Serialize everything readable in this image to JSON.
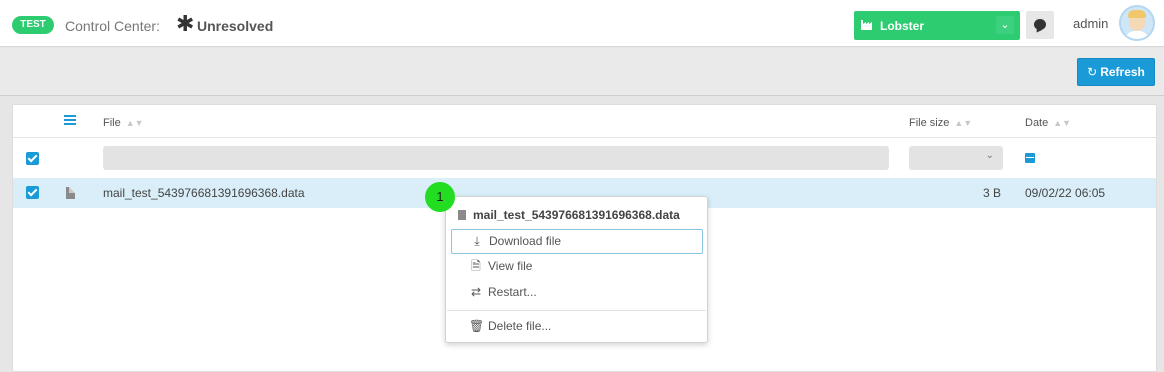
{
  "header": {
    "env_badge": "TEST",
    "control_center_label": "Control Center:",
    "status_symbol": "✱",
    "status_label": "Unresolved",
    "environment_select": "Lobster",
    "user_name": "admin",
    "env_color": "#2ecc71"
  },
  "toolbar": {
    "refresh_label": "Refresh",
    "accent_color": "#1a9bd7"
  },
  "table": {
    "columns": {
      "file": "File",
      "file_size": "File size",
      "date": "Date"
    },
    "rows": [
      {
        "name": "mail_test_543976681391696368.data",
        "size": "3 B",
        "date": "09/02/22 06:05",
        "selected": true
      }
    ]
  },
  "step_badge": "1",
  "context_menu": {
    "title": "mail_test_543976681391696368.data",
    "items": [
      "Download file",
      "View file",
      "Restart...",
      "Delete file..."
    ]
  }
}
